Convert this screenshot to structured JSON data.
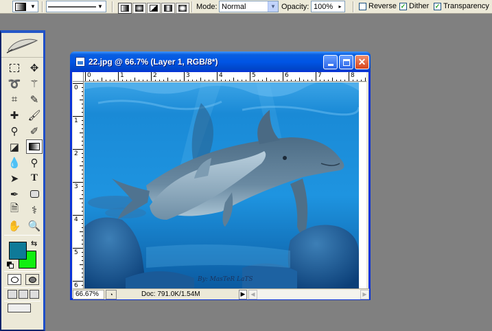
{
  "options_bar": {
    "tool_preset_icon": "gradient-tool-preset-icon",
    "gradient_picker_icon": "gradient-swatch-icon",
    "gradient_types": [
      "linear-gradient-icon",
      "radial-gradient-icon",
      "angle-gradient-icon",
      "reflected-gradient-icon",
      "diamond-gradient-icon"
    ],
    "mode_label": "Mode:",
    "mode_value": "Normal",
    "opacity_label": "Opacity:",
    "opacity_value": "100%",
    "reverse_label": "Reverse",
    "reverse_checked": false,
    "dither_label": "Dither",
    "dither_checked": true,
    "transparency_label": "Transparency",
    "transparency_checked": true
  },
  "toolbox": {
    "logo_icon": "feather-icon",
    "foreground_color": "#0e7a98",
    "background_color": "#10f010",
    "selected_tool": "gradient-tool"
  },
  "document": {
    "title": "22.jpg @ 66.7% (Layer 1, RGB/8*)",
    "ruler_top_numbers": [
      "0",
      "1",
      "2",
      "3",
      "4",
      "5",
      "6",
      "7",
      "8"
    ],
    "ruler_left_numbers": [
      "0",
      "1",
      "2",
      "3",
      "4",
      "5",
      "6"
    ],
    "watermark": "By: MasTeR LaTS",
    "status": {
      "zoom": "66.67%",
      "doc_info": "Doc: 791.0K/1.54M"
    }
  },
  "colors": {
    "desktop": "#808080",
    "titlebar": "#0055e5",
    "window_chrome": "#ece9d8"
  }
}
